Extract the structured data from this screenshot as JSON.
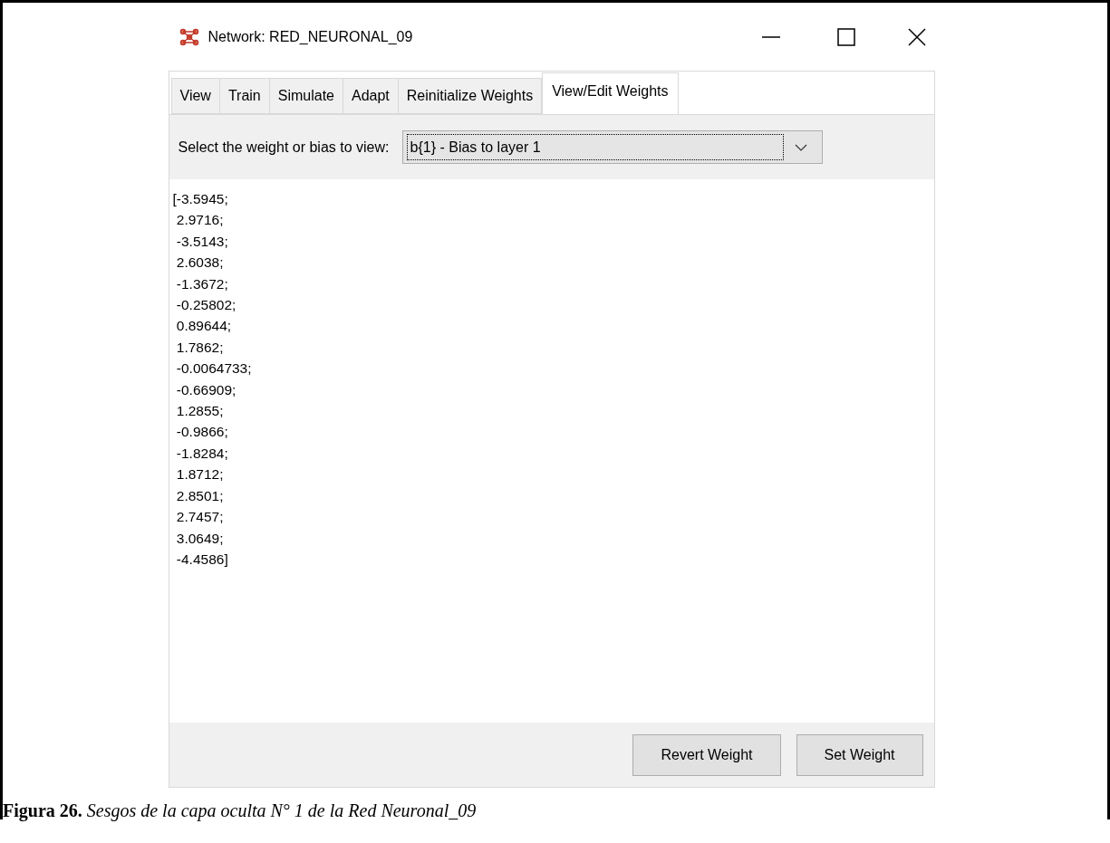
{
  "window": {
    "title": "Network: RED_NEURONAL_09"
  },
  "tabs": [
    {
      "label": "View",
      "selected": false
    },
    {
      "label": "Train",
      "selected": false
    },
    {
      "label": "Simulate",
      "selected": false
    },
    {
      "label": "Adapt",
      "selected": false
    },
    {
      "label": "Reinitialize Weights",
      "selected": false
    },
    {
      "label": "View/Edit Weights",
      "selected": true
    }
  ],
  "selector": {
    "label": "Select the weight or bias to view:",
    "value": "b{1} - Bias to layer 1"
  },
  "values": [
    "[-3.5945;",
    " 2.9716;",
    " -3.5143;",
    " 2.6038;",
    " -1.3672;",
    " -0.25802;",
    " 0.89644;",
    " 1.7862;",
    " -0.0064733;",
    " -0.66909;",
    " 1.2855;",
    " -0.9866;",
    " -1.8284;",
    " 1.8712;",
    " 2.8501;",
    " 2.7457;",
    " 3.0649;",
    " -4.4586]"
  ],
  "buttons": [
    "Revert Weight",
    "Set Weight"
  ],
  "caption": "**Figura 26.** *Sesgos de la capa oculta N° 1 de la Red Neuronal_09*"
}
